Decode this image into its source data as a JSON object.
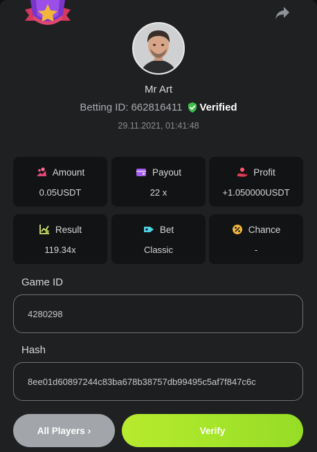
{
  "player": {
    "name": "Mr Art",
    "betting_id_label": "Betting ID:",
    "betting_id": "662816411",
    "verified_label": "Verified",
    "timestamp": "29.11.2021, 01:41:48"
  },
  "stats": [
    {
      "label": "Amount",
      "value": "0.05USDT",
      "icon": "coins-icon"
    },
    {
      "label": "Payout",
      "value": "22 x",
      "icon": "wallet-icon"
    },
    {
      "label": "Profit",
      "value": "+1.050000USDT",
      "icon": "hand-coin-icon"
    },
    {
      "label": "Result",
      "value": "119.34x",
      "icon": "chart-icon"
    },
    {
      "label": "Bet",
      "value": "Classic",
      "icon": "tag-icon"
    },
    {
      "label": "Chance",
      "value": "-",
      "icon": "percent-icon"
    }
  ],
  "game_id": {
    "label": "Game ID",
    "value": "4280298"
  },
  "hash": {
    "label": "Hash",
    "value": "8ee01d60897244c83ba678b38757db99495c5af7f847c6c"
  },
  "buttons": {
    "all_players": "All Players",
    "all_players_chevron": "›",
    "verify": "Verify"
  },
  "colors": {
    "verify_green": "#a6e52a",
    "verified_badge": "#3fbf4a",
    "panel_bg": "#1e2022",
    "card_bg": "#121314"
  }
}
